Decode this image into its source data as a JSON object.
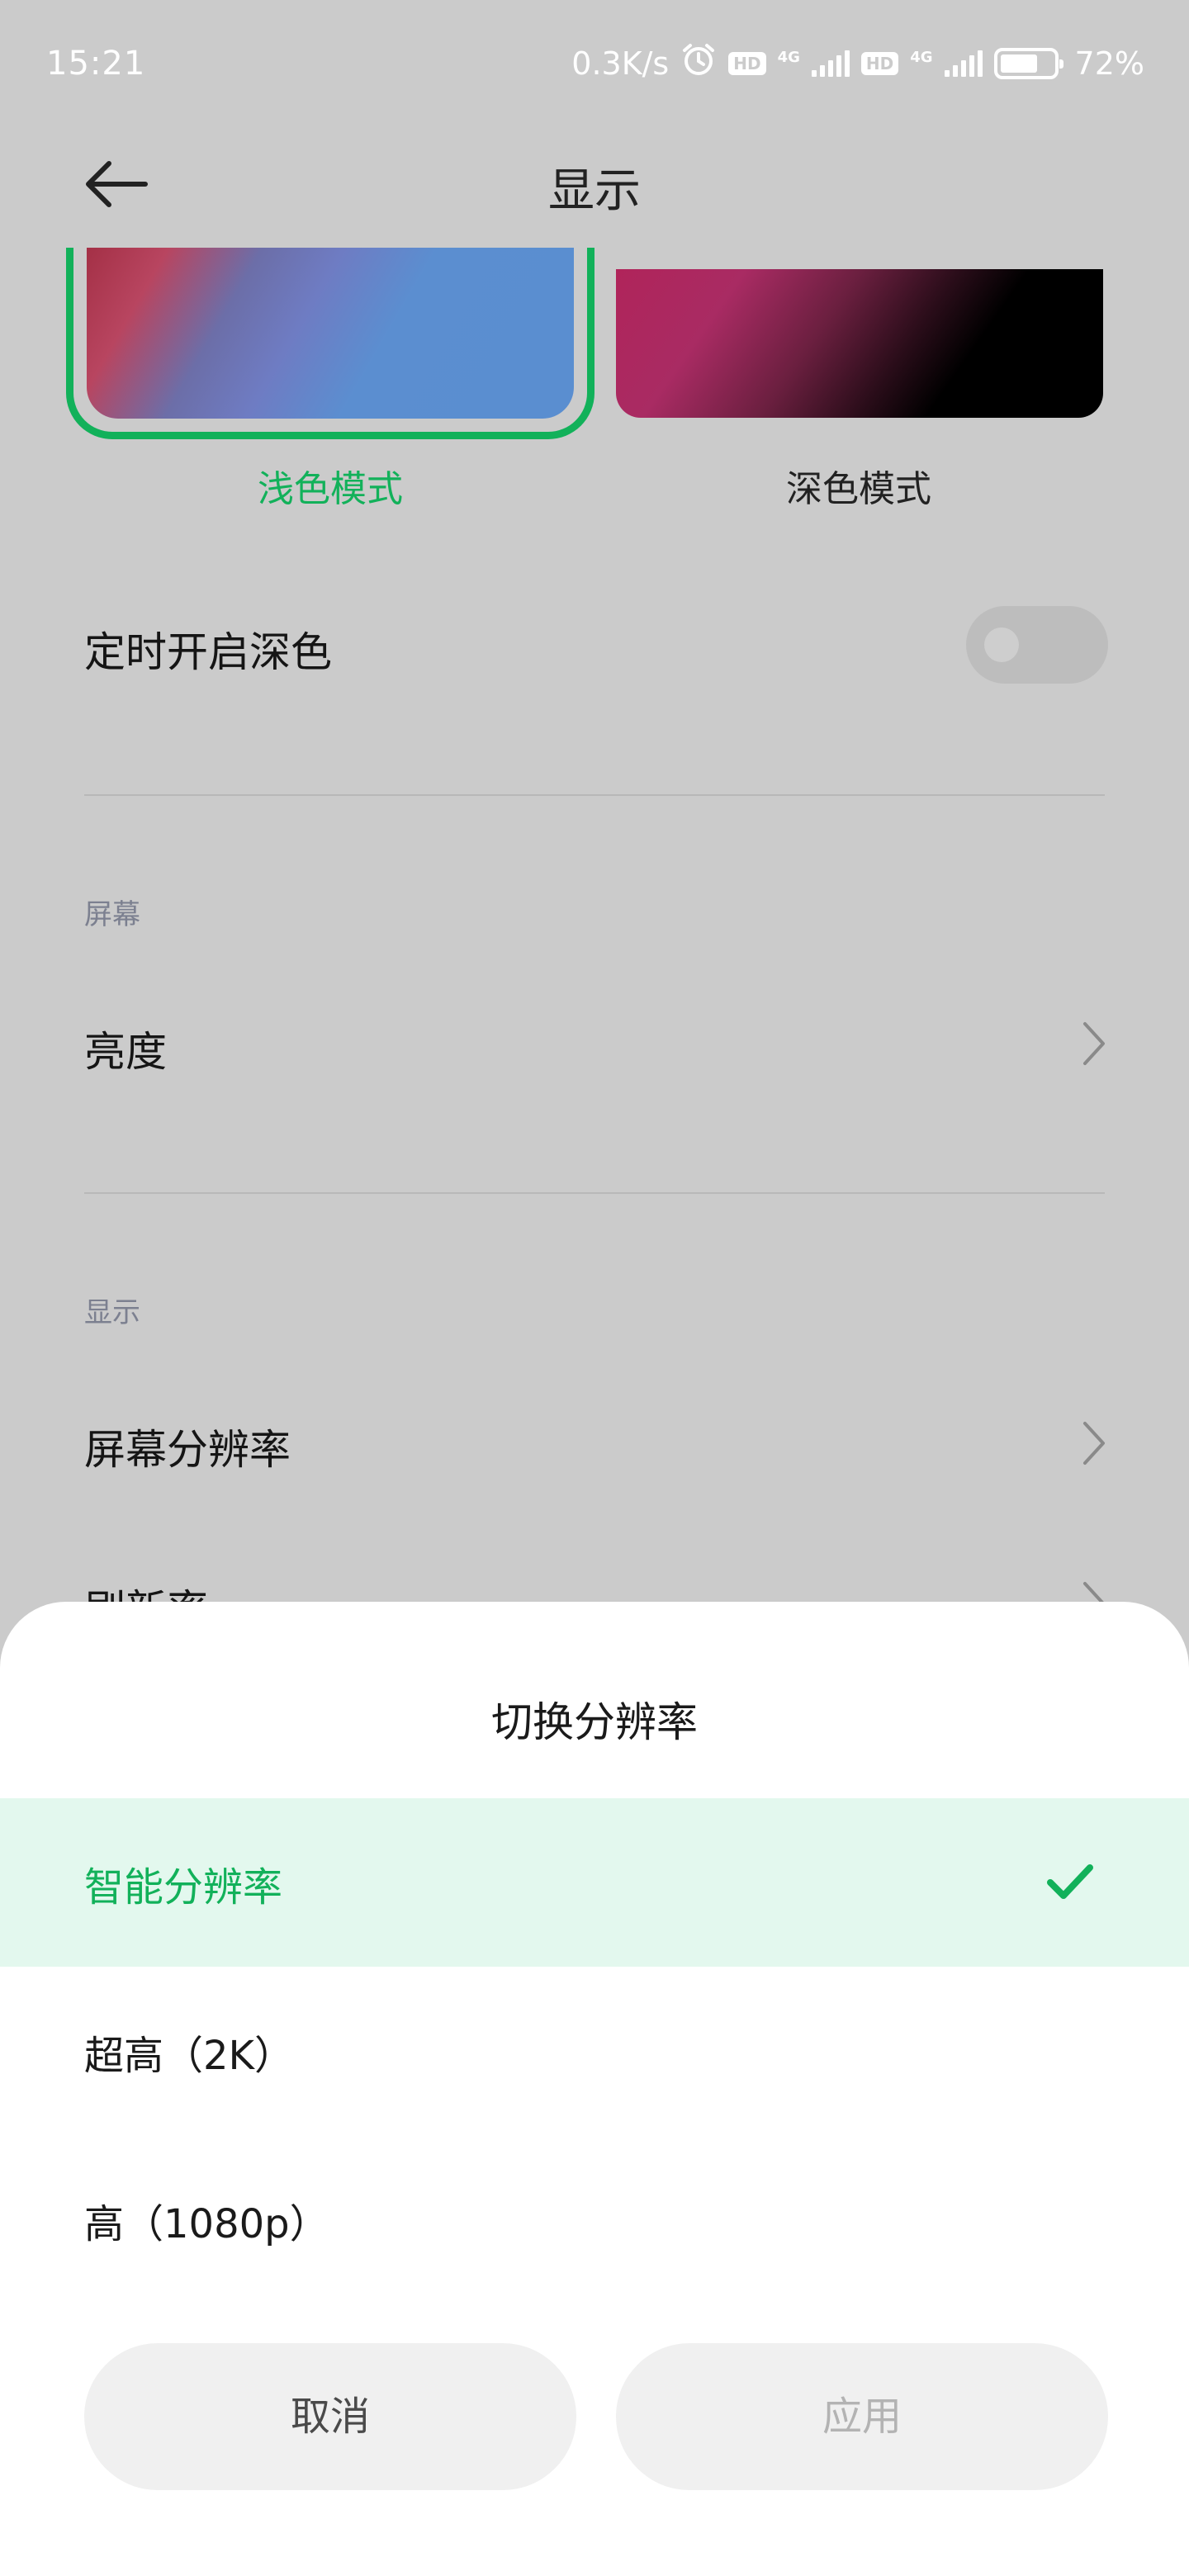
{
  "status_bar": {
    "time": "15:21",
    "net_speed": "0.3K/s",
    "hd_badge_1": "HD",
    "net_1": "4G",
    "hd_badge_2": "HD",
    "net_2": "4G",
    "battery_percent": "72%",
    "battery_level": 0.72,
    "icons": [
      "alarm-clock-icon",
      "signal-icon",
      "battery-icon"
    ]
  },
  "header": {
    "title": "显示",
    "back_icon": "arrow-left-icon"
  },
  "theme": {
    "light_label": "浅色模式",
    "dark_label": "深色模式",
    "selected": "light",
    "accent_color": "#12b15a"
  },
  "settings": {
    "scheduled_dark_label": "定时开启深色",
    "scheduled_dark_on": false,
    "section_screen": "屏幕",
    "brightness_label": "亮度",
    "section_display": "显示",
    "resolution_label": "屏幕分辨率",
    "refresh_label": "刷新率"
  },
  "sheet": {
    "title": "切换分辨率",
    "options": [
      {
        "label": "智能分辨率",
        "selected": true
      },
      {
        "label": "超高（2K）",
        "selected": false
      },
      {
        "label": "高（1080p）",
        "selected": false
      }
    ],
    "cancel_label": "取消",
    "apply_label": "应用"
  }
}
